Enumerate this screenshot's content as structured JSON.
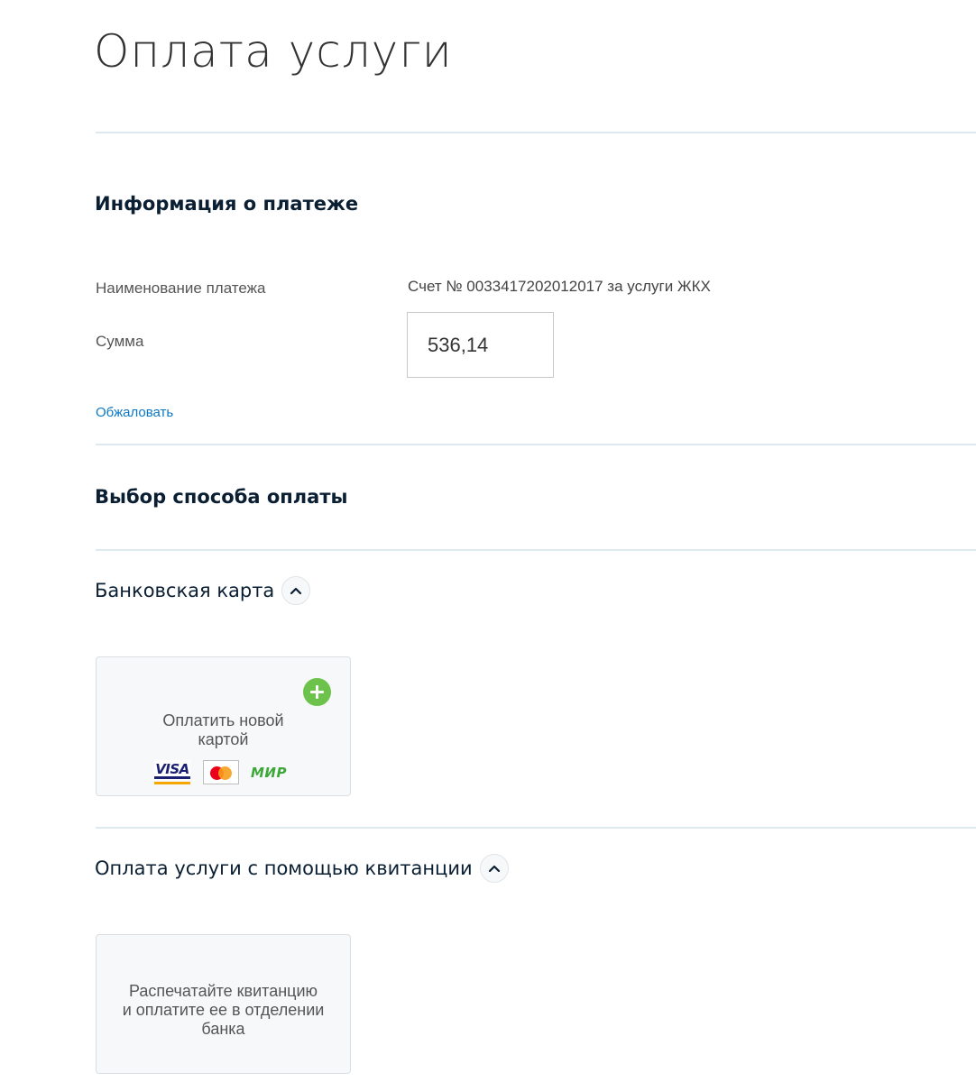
{
  "page": {
    "title": "Оплата услуги"
  },
  "payment_info": {
    "heading": "Информация о платеже",
    "name_label": "Наименование платежа",
    "name_value": "Счет № 0033417202012017 за услуги ЖКХ",
    "amount_label": "Сумма",
    "amount_value": "536,14",
    "appeal_link": "Обжаловать"
  },
  "payment_method": {
    "heading": "Выбор способа оплаты",
    "bank_card": {
      "heading": "Банковская карта",
      "new_card_label": "Оплатить новой\nкартой",
      "logos": {
        "visa": "VISA",
        "mastercard": "mastercard",
        "mir": "МИР"
      }
    },
    "receipt": {
      "heading": "Оплата услуги с помощью квитанции",
      "card_label": "Распечатайте квитанцию\nи оплатите ее в отделении\nбанка"
    }
  },
  "colors": {
    "link": "#0d78c4",
    "divider": "#dde8ef",
    "add_icon": "#6cc24a"
  },
  "icons": {
    "collapse": "chevron-up-icon",
    "add": "plus-circle-icon"
  }
}
